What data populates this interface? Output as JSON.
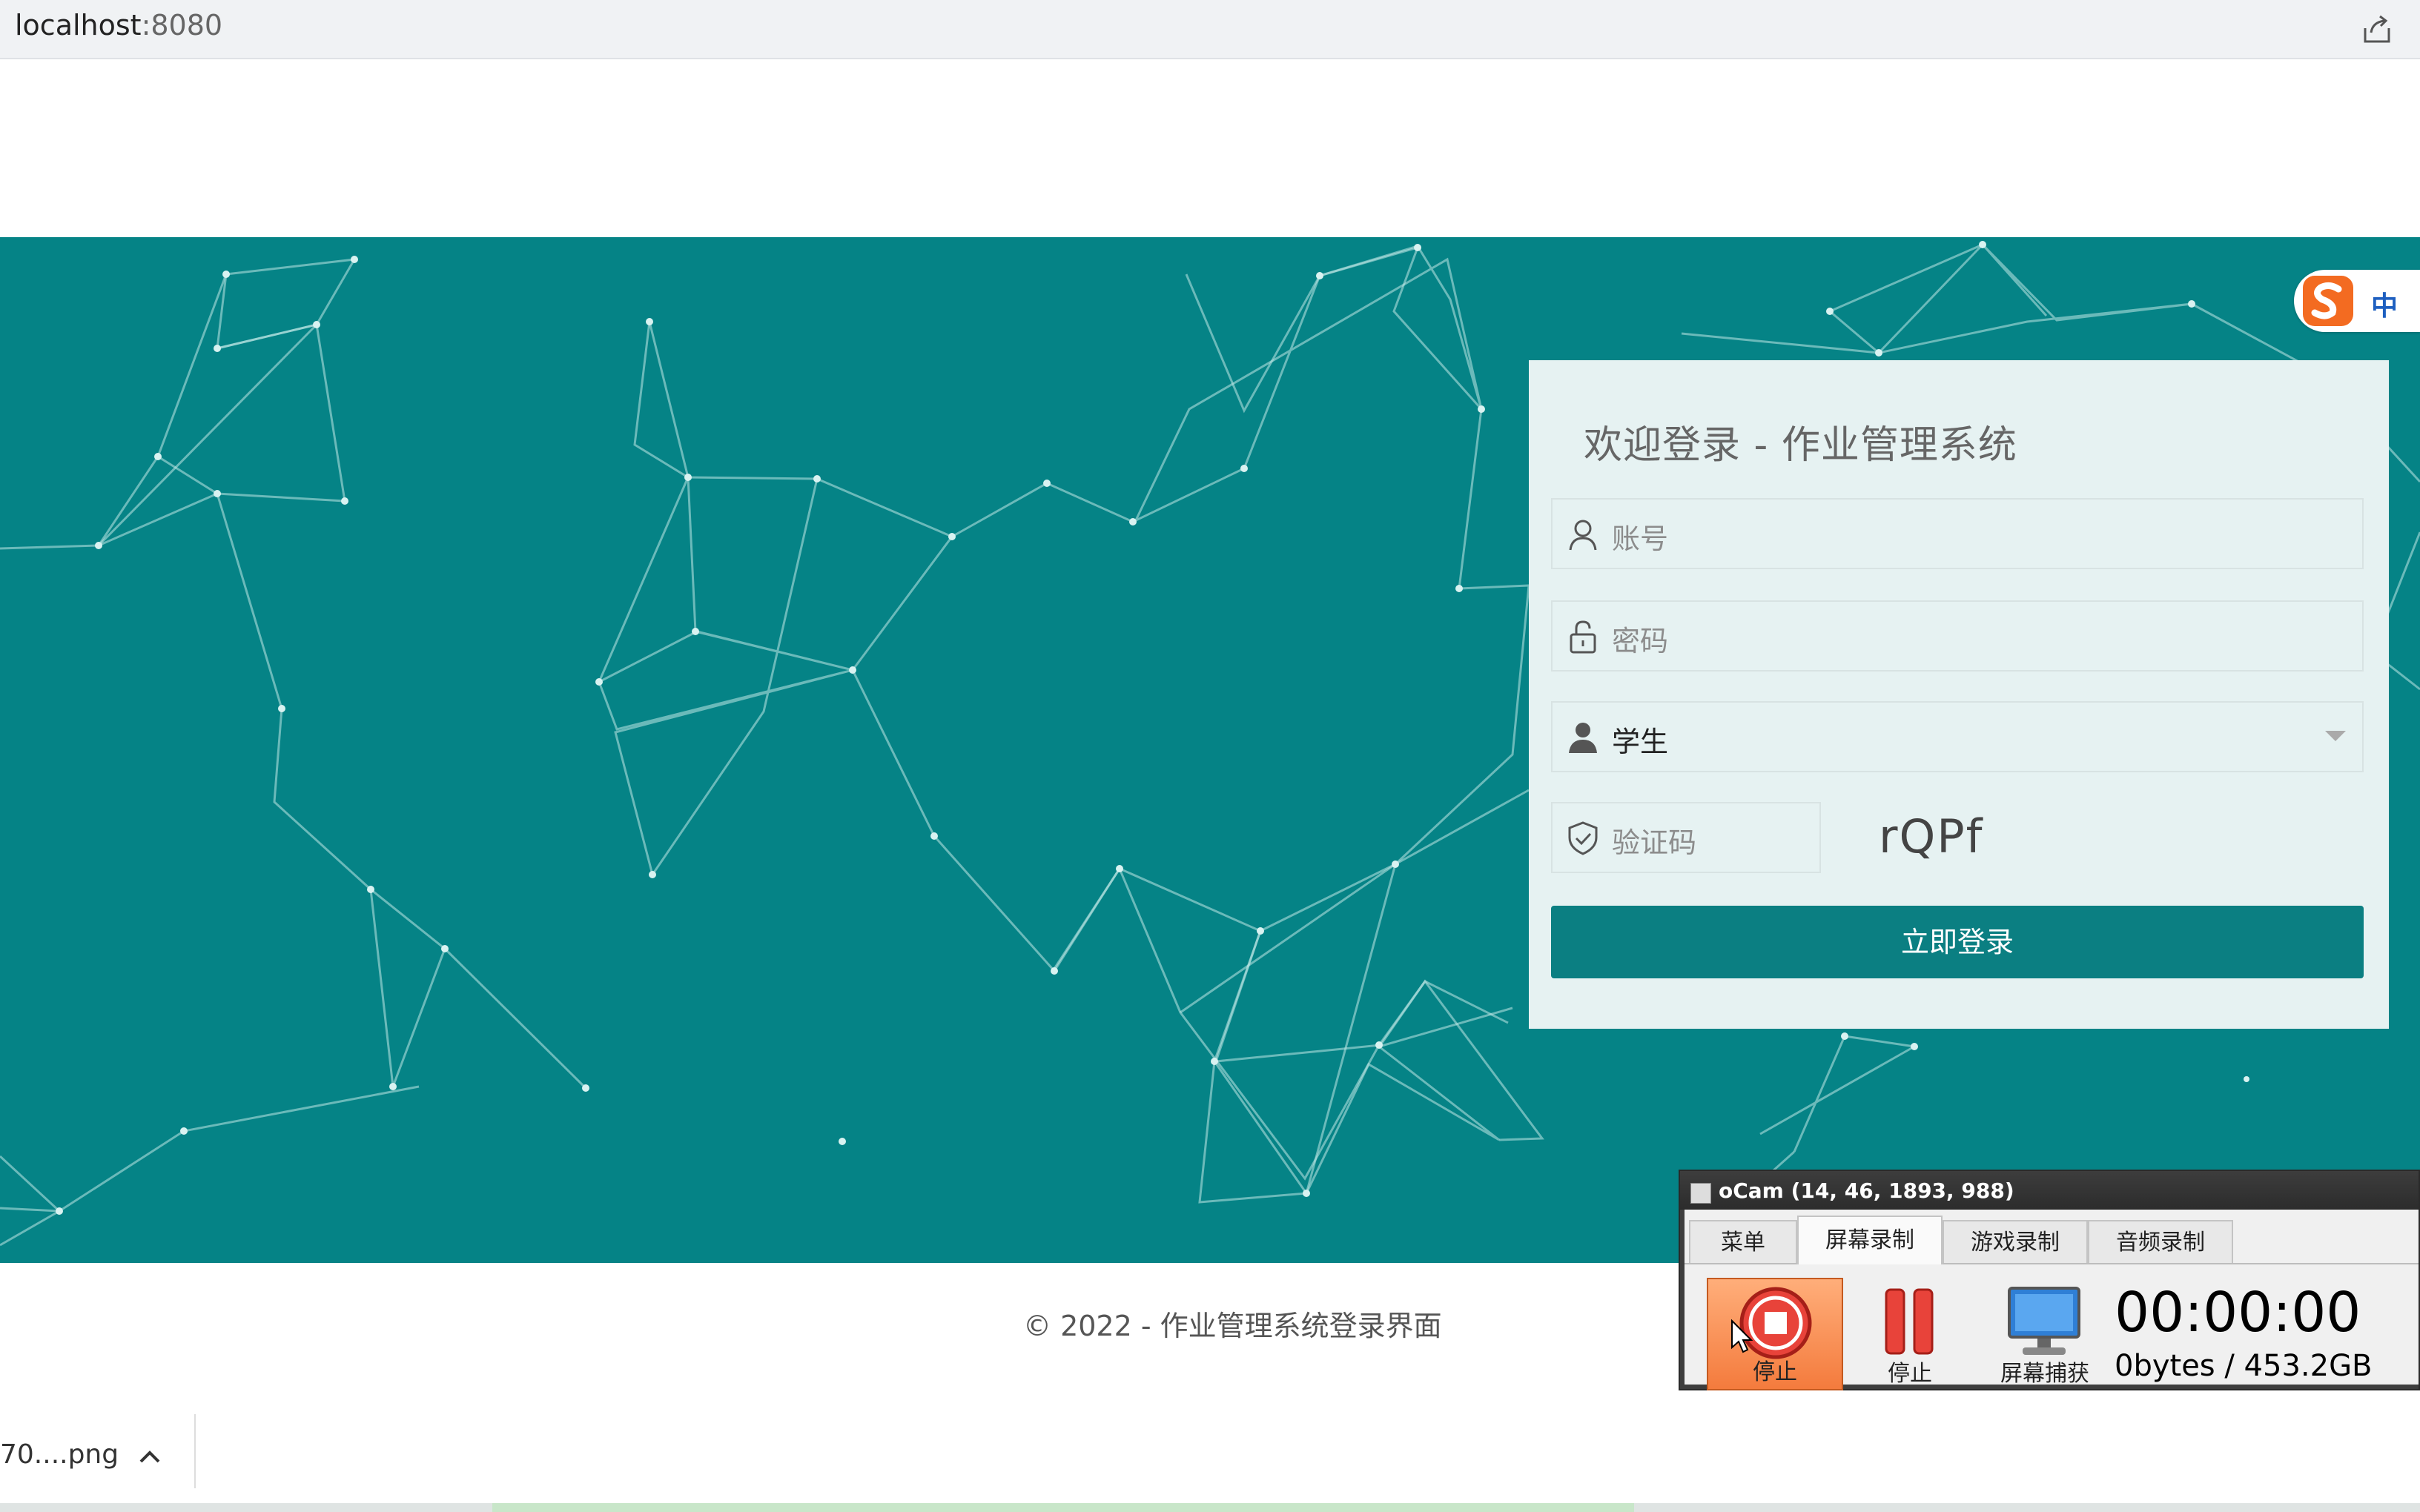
{
  "browser": {
    "url_host": "localhost",
    "url_port": ":8080",
    "share_icon": "share-icon"
  },
  "ime": {
    "logo_icon": "sogou-s-icon",
    "mode": "中"
  },
  "login": {
    "title": "欢迎登录 - 作业管理系统",
    "account_placeholder": "账号",
    "password_placeholder": "密码",
    "role_value": "学生",
    "captcha_placeholder": "验证码",
    "captcha_text": "rQPf",
    "submit_label": "立即登录",
    "accent_color": "#058386"
  },
  "footer": {
    "copyright": "© 2022 - 作业管理系统登录界面"
  },
  "downloads": {
    "item_name": "70....png"
  },
  "ocam": {
    "title": "oCam (14, 46, 1893, 988)",
    "tabs": [
      "菜单",
      "屏幕录制",
      "游戏录制",
      "音频录制"
    ],
    "active_tab": "屏幕录制",
    "tools": [
      {
        "label": "停止",
        "icon": "record-stop-icon"
      },
      {
        "label": "停止",
        "icon": "pause-icon"
      },
      {
        "label": "屏幕捕获",
        "icon": "monitor-capture-icon"
      }
    ],
    "timer": "00:00:00",
    "size": "0bytes / 453.2GB"
  }
}
